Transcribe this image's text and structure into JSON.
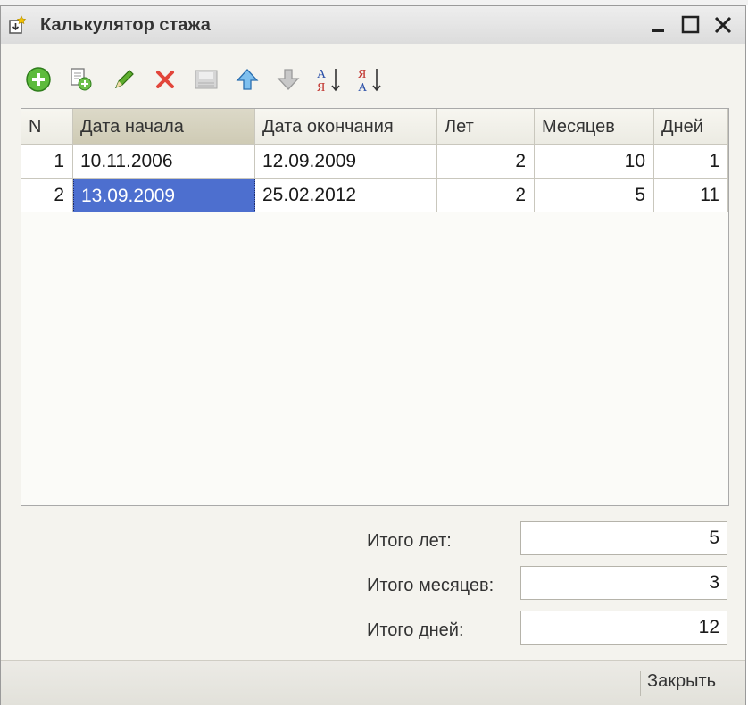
{
  "window": {
    "title": "Калькулятор стажа"
  },
  "toolbar": {
    "icons": [
      "add-icon",
      "copy-icon",
      "edit-icon",
      "delete-icon",
      "save-icon",
      "move-up-icon",
      "move-down-icon",
      "sort-asc-icon",
      "sort-desc-icon"
    ],
    "sort_letters": {
      "a": "А",
      "ya": "Я"
    }
  },
  "table": {
    "columns": [
      "N",
      "Дата начала",
      "Дата окончания",
      "Лет",
      "Месяцев",
      "Дней"
    ],
    "rows": [
      {
        "n": "1",
        "start": "10.11.2006",
        "end": "12.09.2009",
        "years": "2",
        "months": "10",
        "days": "1"
      },
      {
        "n": "2",
        "start": "13.09.2009",
        "end": "25.02.2012",
        "years": "2",
        "months": "5",
        "days": "11"
      }
    ]
  },
  "totals": {
    "years_label": "Итого лет:",
    "years_value": "5",
    "months_label": "Итого месяцев:",
    "months_value": "3",
    "days_label": "Итого дней:",
    "days_value": "12"
  },
  "footer": {
    "close_label": "Закрыть"
  },
  "colors": {
    "selection": "#4d6fcf",
    "header_active": "#d6d3c0",
    "window_bg": "#f4f3ee"
  }
}
